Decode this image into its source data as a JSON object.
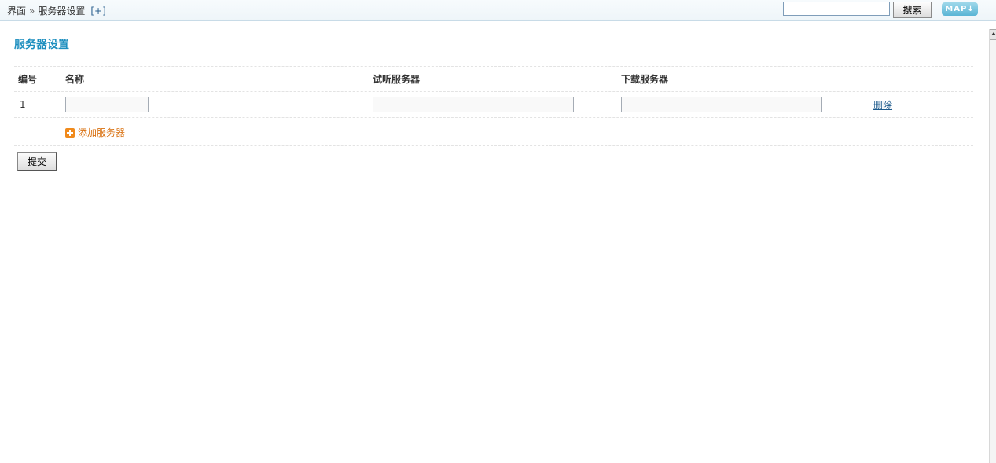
{
  "breadcrumb": {
    "root": "界面",
    "separator": "»",
    "current": "服务器设置",
    "expand": "[+]"
  },
  "header": {
    "search_value": "",
    "search_button": "搜索",
    "map_button": "MAP",
    "map_icon": "arrow-down-icon"
  },
  "page": {
    "title": "服务器设置"
  },
  "table": {
    "columns": [
      "编号",
      "名称",
      "试听服务器",
      "下载服务器"
    ],
    "rows": [
      {
        "number": "1",
        "name": "",
        "preview_server": "",
        "download_server": "",
        "delete": "删除"
      }
    ],
    "add_label": "添加服务器",
    "add_icon": "plus-icon"
  },
  "form": {
    "submit": "提交"
  },
  "colors": {
    "title": "#1e8fbf",
    "add_link": "#d9700f",
    "delete_link": "#1d5a8c",
    "map_button": "#5ab5d5"
  }
}
